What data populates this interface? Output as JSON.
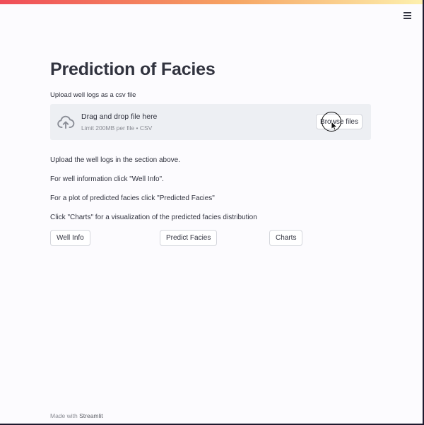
{
  "header": {
    "menu_icon": "hamburger-menu-icon",
    "accent_gradient": [
      "#f04c58",
      "#f6a463",
      "#fdf0ae"
    ]
  },
  "main": {
    "title": "Prediction of Facies",
    "upload": {
      "label": "Upload well logs as a csv file",
      "dropzone_title": "Drag and drop file here",
      "dropzone_limit": "Limit 200MB per file • CSV",
      "browse_label": "Browse files",
      "icon": "cloud-upload-icon"
    },
    "instructions": [
      "Upload the well logs in the section above.",
      "For well information click \"Well Info\".",
      "For a plot of predicted facies click \"Predicted Facies\"",
      "Click \"Charts\" for a visualization of the predicted facies distribution"
    ],
    "buttons": {
      "well_info": "Well Info",
      "predict_facies": "Predict Facies",
      "charts": "Charts"
    }
  },
  "footer": {
    "prefix": "Made with",
    "brand": "Streamlit"
  }
}
